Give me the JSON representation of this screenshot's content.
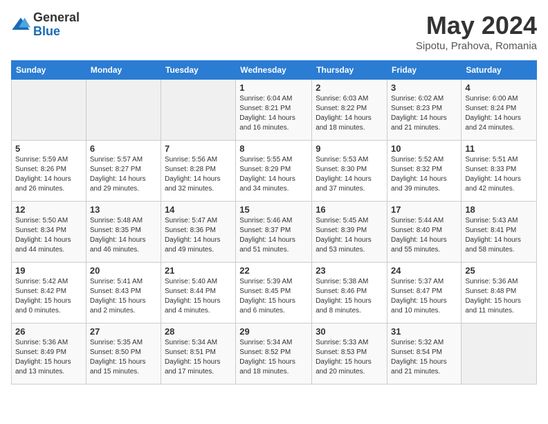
{
  "logo": {
    "general": "General",
    "blue": "Blue"
  },
  "title": "May 2024",
  "location": "Sipotu, Prahova, Romania",
  "days_of_week": [
    "Sunday",
    "Monday",
    "Tuesday",
    "Wednesday",
    "Thursday",
    "Friday",
    "Saturday"
  ],
  "weeks": [
    [
      {
        "day": "",
        "sunrise": "",
        "sunset": "",
        "daylight": ""
      },
      {
        "day": "",
        "sunrise": "",
        "sunset": "",
        "daylight": ""
      },
      {
        "day": "",
        "sunrise": "",
        "sunset": "",
        "daylight": ""
      },
      {
        "day": "1",
        "sunrise": "Sunrise: 6:04 AM",
        "sunset": "Sunset: 8:21 PM",
        "daylight": "Daylight: 14 hours and 16 minutes."
      },
      {
        "day": "2",
        "sunrise": "Sunrise: 6:03 AM",
        "sunset": "Sunset: 8:22 PM",
        "daylight": "Daylight: 14 hours and 18 minutes."
      },
      {
        "day": "3",
        "sunrise": "Sunrise: 6:02 AM",
        "sunset": "Sunset: 8:23 PM",
        "daylight": "Daylight: 14 hours and 21 minutes."
      },
      {
        "day": "4",
        "sunrise": "Sunrise: 6:00 AM",
        "sunset": "Sunset: 8:24 PM",
        "daylight": "Daylight: 14 hours and 24 minutes."
      }
    ],
    [
      {
        "day": "5",
        "sunrise": "Sunrise: 5:59 AM",
        "sunset": "Sunset: 8:26 PM",
        "daylight": "Daylight: 14 hours and 26 minutes."
      },
      {
        "day": "6",
        "sunrise": "Sunrise: 5:57 AM",
        "sunset": "Sunset: 8:27 PM",
        "daylight": "Daylight: 14 hours and 29 minutes."
      },
      {
        "day": "7",
        "sunrise": "Sunrise: 5:56 AM",
        "sunset": "Sunset: 8:28 PM",
        "daylight": "Daylight: 14 hours and 32 minutes."
      },
      {
        "day": "8",
        "sunrise": "Sunrise: 5:55 AM",
        "sunset": "Sunset: 8:29 PM",
        "daylight": "Daylight: 14 hours and 34 minutes."
      },
      {
        "day": "9",
        "sunrise": "Sunrise: 5:53 AM",
        "sunset": "Sunset: 8:30 PM",
        "daylight": "Daylight: 14 hours and 37 minutes."
      },
      {
        "day": "10",
        "sunrise": "Sunrise: 5:52 AM",
        "sunset": "Sunset: 8:32 PM",
        "daylight": "Daylight: 14 hours and 39 minutes."
      },
      {
        "day": "11",
        "sunrise": "Sunrise: 5:51 AM",
        "sunset": "Sunset: 8:33 PM",
        "daylight": "Daylight: 14 hours and 42 minutes."
      }
    ],
    [
      {
        "day": "12",
        "sunrise": "Sunrise: 5:50 AM",
        "sunset": "Sunset: 8:34 PM",
        "daylight": "Daylight: 14 hours and 44 minutes."
      },
      {
        "day": "13",
        "sunrise": "Sunrise: 5:48 AM",
        "sunset": "Sunset: 8:35 PM",
        "daylight": "Daylight: 14 hours and 46 minutes."
      },
      {
        "day": "14",
        "sunrise": "Sunrise: 5:47 AM",
        "sunset": "Sunset: 8:36 PM",
        "daylight": "Daylight: 14 hours and 49 minutes."
      },
      {
        "day": "15",
        "sunrise": "Sunrise: 5:46 AM",
        "sunset": "Sunset: 8:37 PM",
        "daylight": "Daylight: 14 hours and 51 minutes."
      },
      {
        "day": "16",
        "sunrise": "Sunrise: 5:45 AM",
        "sunset": "Sunset: 8:39 PM",
        "daylight": "Daylight: 14 hours and 53 minutes."
      },
      {
        "day": "17",
        "sunrise": "Sunrise: 5:44 AM",
        "sunset": "Sunset: 8:40 PM",
        "daylight": "Daylight: 14 hours and 55 minutes."
      },
      {
        "day": "18",
        "sunrise": "Sunrise: 5:43 AM",
        "sunset": "Sunset: 8:41 PM",
        "daylight": "Daylight: 14 hours and 58 minutes."
      }
    ],
    [
      {
        "day": "19",
        "sunrise": "Sunrise: 5:42 AM",
        "sunset": "Sunset: 8:42 PM",
        "daylight": "Daylight: 15 hours and 0 minutes."
      },
      {
        "day": "20",
        "sunrise": "Sunrise: 5:41 AM",
        "sunset": "Sunset: 8:43 PM",
        "daylight": "Daylight: 15 hours and 2 minutes."
      },
      {
        "day": "21",
        "sunrise": "Sunrise: 5:40 AM",
        "sunset": "Sunset: 8:44 PM",
        "daylight": "Daylight: 15 hours and 4 minutes."
      },
      {
        "day": "22",
        "sunrise": "Sunrise: 5:39 AM",
        "sunset": "Sunset: 8:45 PM",
        "daylight": "Daylight: 15 hours and 6 minutes."
      },
      {
        "day": "23",
        "sunrise": "Sunrise: 5:38 AM",
        "sunset": "Sunset: 8:46 PM",
        "daylight": "Daylight: 15 hours and 8 minutes."
      },
      {
        "day": "24",
        "sunrise": "Sunrise: 5:37 AM",
        "sunset": "Sunset: 8:47 PM",
        "daylight": "Daylight: 15 hours and 10 minutes."
      },
      {
        "day": "25",
        "sunrise": "Sunrise: 5:36 AM",
        "sunset": "Sunset: 8:48 PM",
        "daylight": "Daylight: 15 hours and 11 minutes."
      }
    ],
    [
      {
        "day": "26",
        "sunrise": "Sunrise: 5:36 AM",
        "sunset": "Sunset: 8:49 PM",
        "daylight": "Daylight: 15 hours and 13 minutes."
      },
      {
        "day": "27",
        "sunrise": "Sunrise: 5:35 AM",
        "sunset": "Sunset: 8:50 PM",
        "daylight": "Daylight: 15 hours and 15 minutes."
      },
      {
        "day": "28",
        "sunrise": "Sunrise: 5:34 AM",
        "sunset": "Sunset: 8:51 PM",
        "daylight": "Daylight: 15 hours and 17 minutes."
      },
      {
        "day": "29",
        "sunrise": "Sunrise: 5:34 AM",
        "sunset": "Sunset: 8:52 PM",
        "daylight": "Daylight: 15 hours and 18 minutes."
      },
      {
        "day": "30",
        "sunrise": "Sunrise: 5:33 AM",
        "sunset": "Sunset: 8:53 PM",
        "daylight": "Daylight: 15 hours and 20 minutes."
      },
      {
        "day": "31",
        "sunrise": "Sunrise: 5:32 AM",
        "sunset": "Sunset: 8:54 PM",
        "daylight": "Daylight: 15 hours and 21 minutes."
      },
      {
        "day": "",
        "sunrise": "",
        "sunset": "",
        "daylight": ""
      }
    ]
  ]
}
